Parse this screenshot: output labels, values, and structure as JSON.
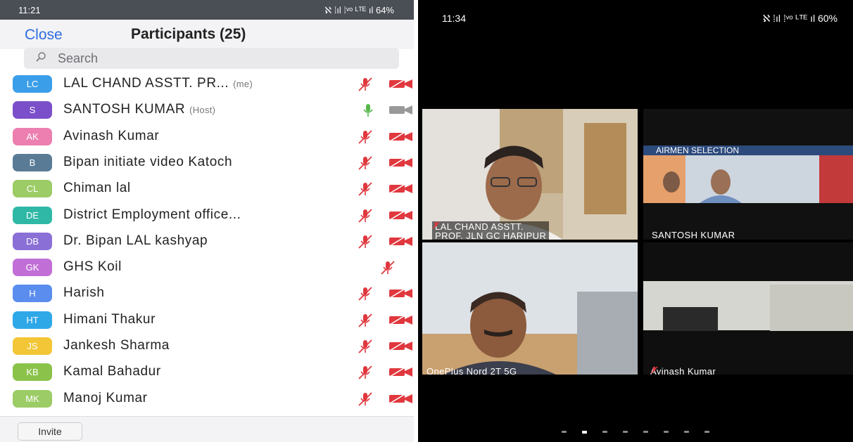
{
  "left_screen": {
    "status": {
      "time": "11:21",
      "icons": "ℵ ⁞ıl ⁞ᵛᵒ ᴸᵀᴱ ıl 64%"
    },
    "header": {
      "close_label": "Close",
      "title": "Participants (25)"
    },
    "search": {
      "placeholder": "Search"
    },
    "participants": [
      {
        "initials": "LC",
        "name": "LAL CHAND ASSTT. PR...",
        "tag": "(me)",
        "color": "#3b9ee9",
        "mic_muted": true,
        "video_off": true
      },
      {
        "initials": "S",
        "name": "SANTOSH KUMAR",
        "tag": "(Host)",
        "color": "#7a4fc9",
        "mic_muted": false,
        "video_off": false
      },
      {
        "initials": "AK",
        "name": "Avinash Kumar",
        "tag": "",
        "color": "#ec7fb0",
        "mic_muted": true,
        "video_off": true
      },
      {
        "initials": "B",
        "name": "Bipan initiate video Katoch",
        "tag": "",
        "color": "#5a7b96",
        "mic_muted": true,
        "video_off": true
      },
      {
        "initials": "CL",
        "name": "Chiman lal",
        "tag": "",
        "color": "#9ccc65",
        "mic_muted": true,
        "video_off": true
      },
      {
        "initials": "DE",
        "name": "District Employment office...",
        "tag": "",
        "color": "#2fb8a6",
        "mic_muted": true,
        "video_off": true
      },
      {
        "initials": "DB",
        "name": "Dr. Bipan LAL kashyap",
        "tag": "",
        "color": "#8a6fd6",
        "mic_muted": true,
        "video_off": true
      },
      {
        "initials": "GK",
        "name": "GHS Koil",
        "tag": "",
        "color": "#c16fd6",
        "mic_muted": true,
        "video_off": null
      },
      {
        "initials": "H",
        "name": "Harish",
        "tag": "",
        "color": "#5b8def",
        "mic_muted": true,
        "video_off": true
      },
      {
        "initials": "HT",
        "name": "Himani Thakur",
        "tag": "",
        "color": "#2fa8e8",
        "mic_muted": true,
        "video_off": true
      },
      {
        "initials": "JS",
        "name": "Jankesh Sharma",
        "tag": "",
        "color": "#f2c636",
        "mic_muted": true,
        "video_off": true
      },
      {
        "initials": "KB",
        "name": "Kamal Bahadur",
        "tag": "",
        "color": "#8bc34a",
        "mic_muted": true,
        "video_off": true
      },
      {
        "initials": "MK",
        "name": "Manoj Kumar",
        "tag": "",
        "color": "#9ccc65",
        "mic_muted": true,
        "video_off": true
      }
    ],
    "invite_label": "Invite"
  },
  "right_screen": {
    "status": {
      "time": "11:34",
      "icons": "ℵ ⁞ıl ⁞ᵛᵒ ᴸᵀᴱ ıl 60%"
    },
    "tiles": [
      {
        "label_line1": "LAL CHAND ASSTT.",
        "label_line2": "PROF. JLN GC HARIPUR",
        "muted": true
      },
      {
        "label": "SANTOSH KUMAR",
        "muted": false,
        "background_text": "AIRMEN SELECTION"
      },
      {
        "label": "OnePlus Nord 2T 5G",
        "muted": false
      },
      {
        "label": "Avinash Kumar",
        "muted": true
      }
    ],
    "pager": {
      "pages": 8,
      "active_index": 1
    }
  },
  "colors": {
    "link_blue": "#2d6be0",
    "muted_red": "#e0383e",
    "active_green": "#56b84a",
    "video_gray": "#999999"
  }
}
